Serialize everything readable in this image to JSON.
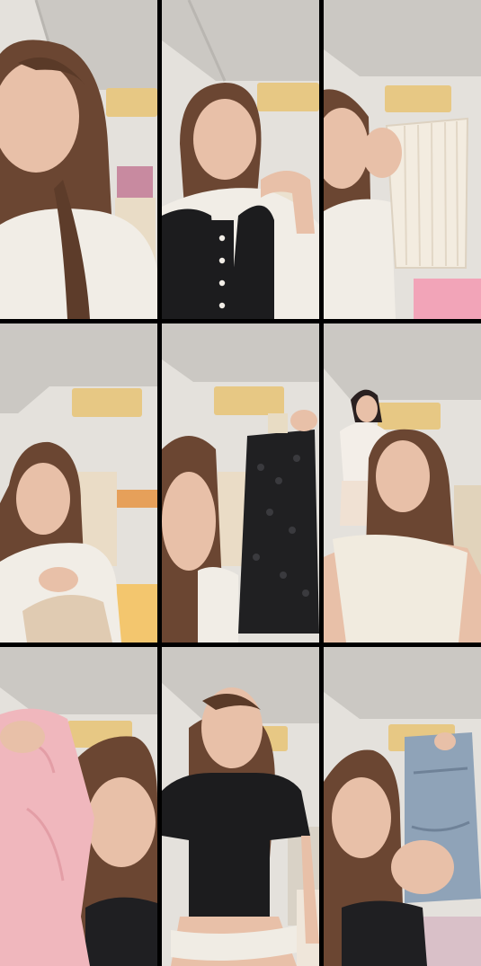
{
  "layout": {
    "rows": 3,
    "cols": 3
  },
  "colors": {
    "background_gutter": "#000000",
    "ceiling": "#c9c7c2",
    "wall": "#e6e3df",
    "ac_unit": "#e7c884",
    "hair": "#6b4632",
    "skin": "#e8c0a8",
    "shirt_white": "#f1ede6",
    "vest_black": "#1c1c1e",
    "pink_garment": "#f0b7bd",
    "denim": "#8fa3b8",
    "lace_black": "#202022",
    "knit_cream": "#f3ece0"
  },
  "tiles": [
    {
      "pose": "looking-up-left",
      "outfit": "white-tee"
    },
    {
      "pose": "hand-on-shelf",
      "outfit": "black-button-vest"
    },
    {
      "pose": "holding-cream-knit-top",
      "outfit": "white-tee"
    },
    {
      "pose": "folding-garment",
      "outfit": "white-tee"
    },
    {
      "pose": "holding-black-lace-top",
      "outfit": "white-tee"
    },
    {
      "pose": "off-shoulder-top-with-person-behind",
      "outfit": "cream-off-shoulder"
    },
    {
      "pose": "holding-pink-garment",
      "outfit": "black-top"
    },
    {
      "pose": "standing-front",
      "outfit": "black-crop-top"
    },
    {
      "pose": "holding-denim-shorts",
      "outfit": "black-top"
    }
  ]
}
